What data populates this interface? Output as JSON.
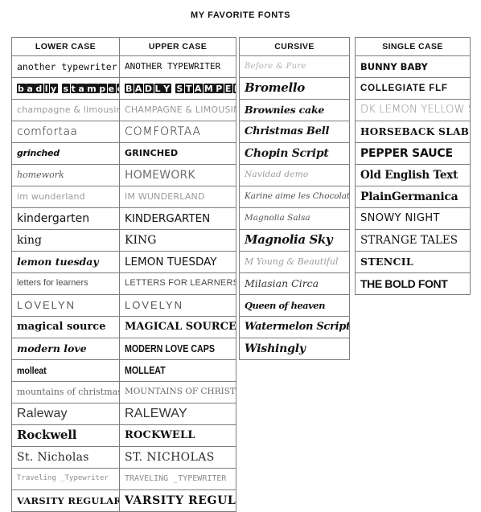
{
  "page": {
    "title": "MY FAVORITE FONTS",
    "background_color": "#ffffff",
    "text_color": "#111111",
    "border_color": "#7d7d7d"
  },
  "tables": {
    "lower_upper": {
      "headers": [
        "LOWER CASE",
        "UPPER CASE"
      ],
      "rows": [
        {
          "lower": "another typewriter",
          "upper": "ANOTHER TYPEWRITER"
        },
        {
          "lower": "badly stamped",
          "upper": "BADLY STAMPED"
        },
        {
          "lower": "champagne & limousines",
          "upper": "CHAMPAGNE & LIMOUSINES"
        },
        {
          "lower": "comfortaa",
          "upper": "COMFORTAA"
        },
        {
          "lower": "grinched",
          "upper": "GRINCHED"
        },
        {
          "lower": "homework",
          "upper": "HOMEWORK"
        },
        {
          "lower": "im wunderland",
          "upper": "IM WUNDERLAND"
        },
        {
          "lower": "kindergarten",
          "upper": "KINDERGARTEN"
        },
        {
          "lower": "king",
          "upper": "KING"
        },
        {
          "lower": "lemon tuesday",
          "upper": "LEMON TUESDAY"
        },
        {
          "lower": "letters for learners",
          "upper": "LETTERS FOR LEARNERS"
        },
        {
          "lower": "LOVELYN",
          "upper": "LOVELYN"
        },
        {
          "lower": "magical source",
          "upper": "MAGICAL SOURCE"
        },
        {
          "lower": "modern love",
          "upper": "MODERN LOVE CAPS"
        },
        {
          "lower": "molleat",
          "upper": "MOLLEAT"
        },
        {
          "lower": "mountains of christmas",
          "upper": "MOUNTAINS OF CHRISTMAS"
        },
        {
          "lower": "Raleway",
          "upper": "RALEWAY"
        },
        {
          "lower": "Rockwell",
          "upper": "ROCKWELL"
        },
        {
          "lower": "St. Nicholas",
          "upper": "ST. NICHOLAS"
        },
        {
          "lower": "Traveling _Typewriter",
          "upper": "TRAVELING _TYPEWRITER"
        },
        {
          "lower": "VARSITY REGULAR",
          "upper": "VARSITY REGULAR"
        }
      ]
    },
    "cursive": {
      "header": "CURSIVE",
      "rows": [
        "Before & Pure",
        "Bromello",
        "Brownies cake",
        "Christmas Bell",
        "Chopin Script",
        "Navidad demo",
        "Karine aime les Chocolats",
        "Magnolia Salsa",
        "Magnolia Sky",
        "M Young & Beautiful",
        "Milasian Circa",
        "Queen of heaven",
        "Watermelon Script",
        "Wishingly"
      ]
    },
    "single_case": {
      "header": "SINGLE CASE",
      "rows": [
        "BUNNY BABY",
        "COLLEGIATE FLF",
        "DK LEMON YELLOW SUN",
        "HORSEBACK SLAB",
        "PEPPER SAUCE",
        "Old English Text",
        "PlainGermanica",
        "SNOWY NIGHT",
        "STRANGE TALES",
        "STENCIL",
        "THE BOLD FONT"
      ]
    }
  }
}
